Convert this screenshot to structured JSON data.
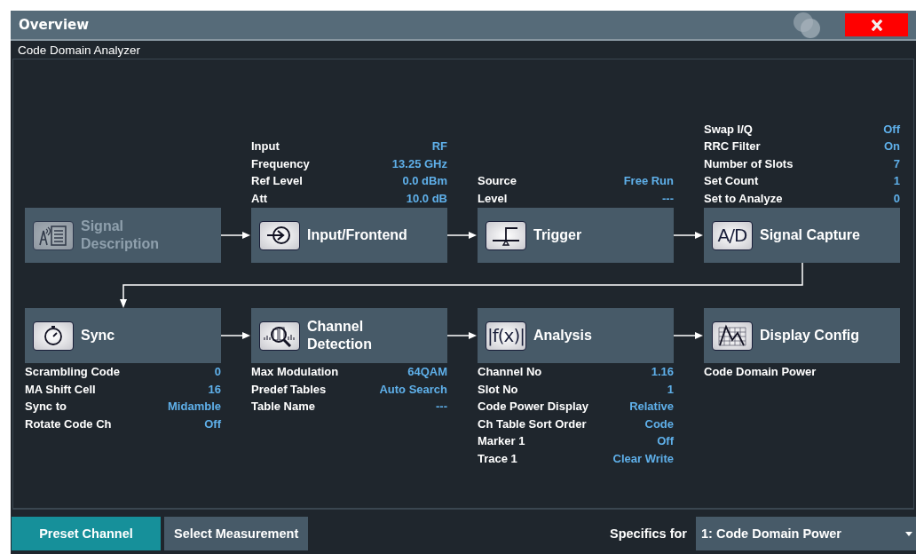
{
  "window": {
    "title": "Overview",
    "subtitle": "Code Domain Analyzer"
  },
  "top_blocks": [
    {
      "label": "Signal Description",
      "disabled": true
    },
    {
      "label": "Input/Frontend",
      "disabled": false,
      "settings": [
        {
          "label": "Input",
          "value": "RF"
        },
        {
          "label": "Frequency",
          "value": "13.25 GHz"
        },
        {
          "label": "Ref Level",
          "value": "0.0 dBm"
        },
        {
          "label": "Att",
          "value": "10.0 dB"
        }
      ]
    },
    {
      "label": "Trigger",
      "disabled": false,
      "settings": [
        {
          "label": "Source",
          "value": "Free Run"
        },
        {
          "label": "Level",
          "value": "---"
        }
      ]
    },
    {
      "label": "Signal Capture",
      "disabled": false,
      "icon_text": "A/D",
      "settings": [
        {
          "label": "Swap I/Q",
          "value": "Off"
        },
        {
          "label": "RRC Filter",
          "value": "On"
        },
        {
          "label": "Number of Slots",
          "value": "7"
        },
        {
          "label": "Set Count",
          "value": "1"
        },
        {
          "label": "Set to Analyze",
          "value": "0"
        }
      ]
    }
  ],
  "bottom_blocks": [
    {
      "label": "Sync",
      "disabled": false,
      "settings": [
        {
          "label": "Scrambling Code",
          "value": "0"
        },
        {
          "label": "MA Shift Cell",
          "value": "16"
        },
        {
          "label": "Sync to",
          "value": "Midamble"
        },
        {
          "label": "Rotate Code Ch",
          "value": "Off"
        }
      ]
    },
    {
      "label": "Channel Detection",
      "disabled": false,
      "settings": [
        {
          "label": "Max Modulation",
          "value": "64QAM"
        },
        {
          "label": "Predef Tables",
          "value": "Auto Search"
        },
        {
          "label": "Table Name",
          "value": "---"
        }
      ]
    },
    {
      "label": "Analysis",
      "disabled": false,
      "icon_text": "|f(x)|",
      "settings": [
        {
          "label": "Channel No",
          "value": "1.16"
        },
        {
          "label": "Slot No",
          "value": "1"
        },
        {
          "label": "Code Power Display",
          "value": "Relative"
        },
        {
          "label": "Ch Table Sort Order",
          "value": "Code"
        },
        {
          "label": "Marker 1",
          "value": "Off"
        },
        {
          "label": "Trace 1",
          "value": "Clear Write"
        }
      ]
    },
    {
      "label": "Display Config",
      "disabled": false,
      "settings": [
        {
          "label": "Code Domain Power"
        }
      ]
    }
  ],
  "footer": {
    "preset_button": "Preset Channel",
    "select_button": "Select Measurement",
    "specifics_label": "Specifics for",
    "specifics_value": "1: Code Domain Power"
  }
}
